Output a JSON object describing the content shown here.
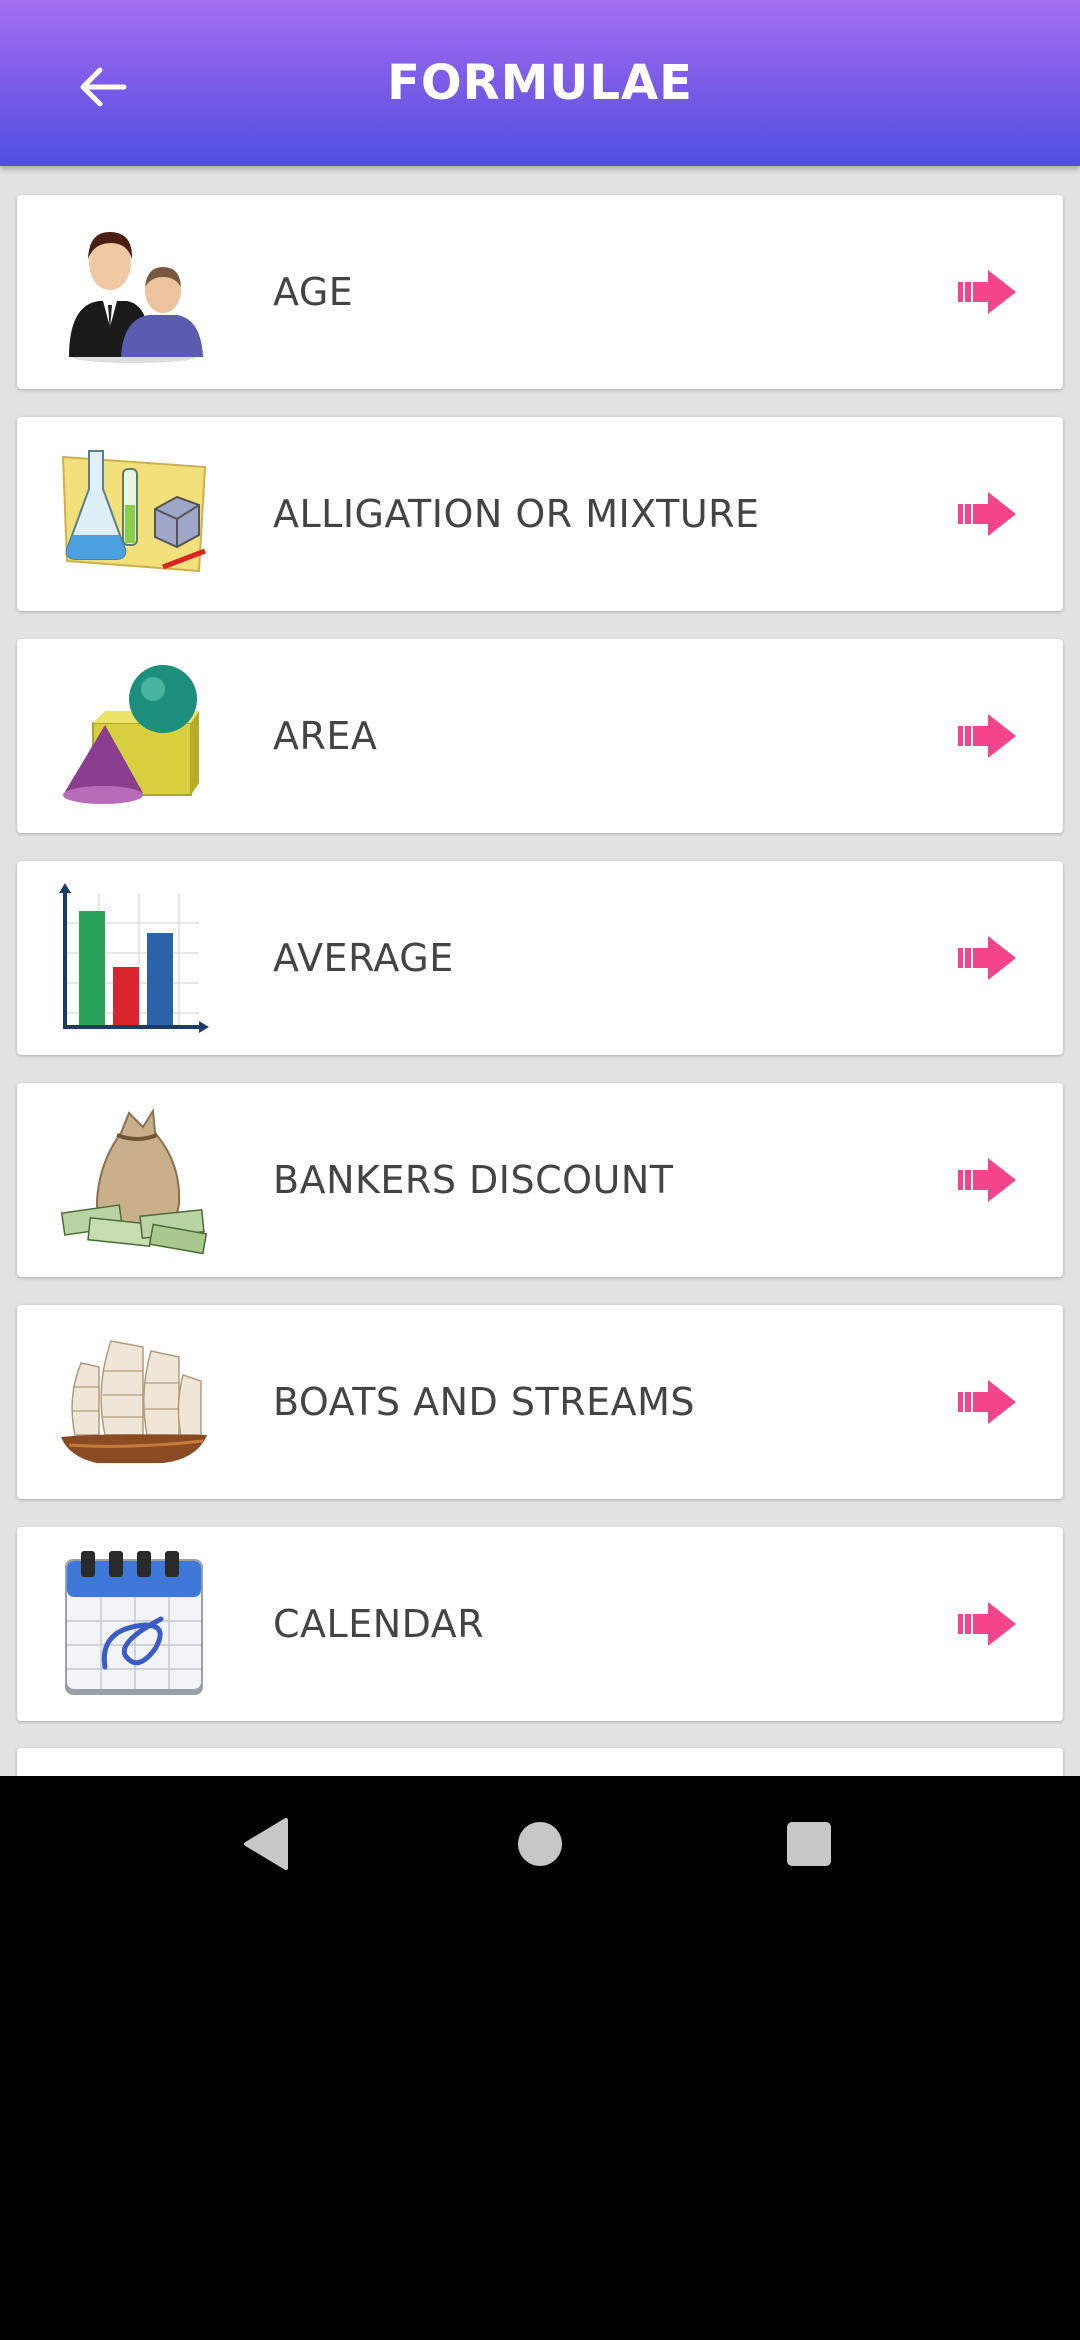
{
  "header": {
    "title": "FORMULAE",
    "back_icon": "arrow-left-icon"
  },
  "colors": {
    "header_top": "#a46ff2",
    "header_bottom": "#4f4fe0",
    "arrow": "#f5458a",
    "background": "#e2e2e2",
    "label": "#444444"
  },
  "topics": [
    {
      "label": "AGE",
      "icon": "people-icon"
    },
    {
      "label": "ALLIGATION OR MIXTURE",
      "icon": "lab-flasks-icon"
    },
    {
      "label": "AREA",
      "icon": "geometric-shapes-icon"
    },
    {
      "label": "AVERAGE",
      "icon": "bar-chart-icon"
    },
    {
      "label": "BANKERS DISCOUNT",
      "icon": "money-bag-icon"
    },
    {
      "label": "BOATS AND STREAMS",
      "icon": "sailboat-icon"
    },
    {
      "label": "CALENDAR",
      "icon": "calendar-icon"
    }
  ],
  "system_nav": {
    "back": "nav-back-icon",
    "home": "nav-home-icon",
    "recents": "nav-recents-icon"
  }
}
